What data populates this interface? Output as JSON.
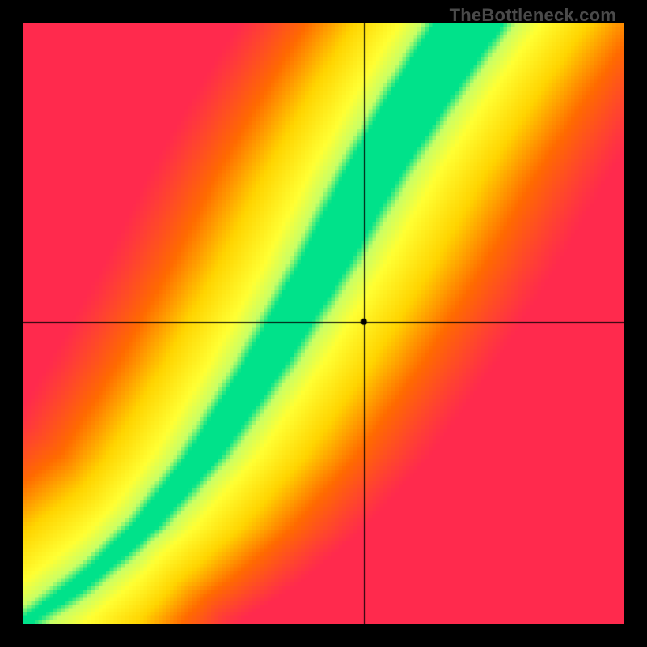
{
  "watermark": "TheBottleneck.com",
  "chart_data": {
    "type": "heatmap",
    "title": "",
    "xlabel": "",
    "ylabel": "",
    "xlim": [
      0,
      1
    ],
    "ylim": [
      0,
      1
    ],
    "grid": false,
    "legend": false,
    "crosshair": {
      "x": 0.567,
      "y": 0.503
    },
    "marker": {
      "x": 0.567,
      "y": 0.503,
      "color": "#000000"
    },
    "colormap": {
      "stops": [
        {
          "t": 0.0,
          "hex": "#ff2a4d"
        },
        {
          "t": 0.3,
          "hex": "#ff6a00"
        },
        {
          "t": 0.55,
          "hex": "#ffd400"
        },
        {
          "t": 0.8,
          "hex": "#ffff33"
        },
        {
          "t": 0.93,
          "hex": "#c8ff66"
        },
        {
          "t": 1.0,
          "hex": "#00e28a"
        }
      ]
    },
    "ridge": {
      "description": "approximate centerline of the green optimal band (y as function of x, normalized 0..1 with origin bottom-left)",
      "points": [
        {
          "x": 0.0,
          "y": 0.0
        },
        {
          "x": 0.1,
          "y": 0.07
        },
        {
          "x": 0.2,
          "y": 0.16
        },
        {
          "x": 0.3,
          "y": 0.28
        },
        {
          "x": 0.4,
          "y": 0.43
        },
        {
          "x": 0.5,
          "y": 0.6
        },
        {
          "x": 0.58,
          "y": 0.75
        },
        {
          "x": 0.66,
          "y": 0.88
        },
        {
          "x": 0.74,
          "y": 1.0
        }
      ],
      "band_halfwidth_start": 0.008,
      "band_halfwidth_end": 0.06
    },
    "falloff_scale": 0.35,
    "annotations": []
  }
}
